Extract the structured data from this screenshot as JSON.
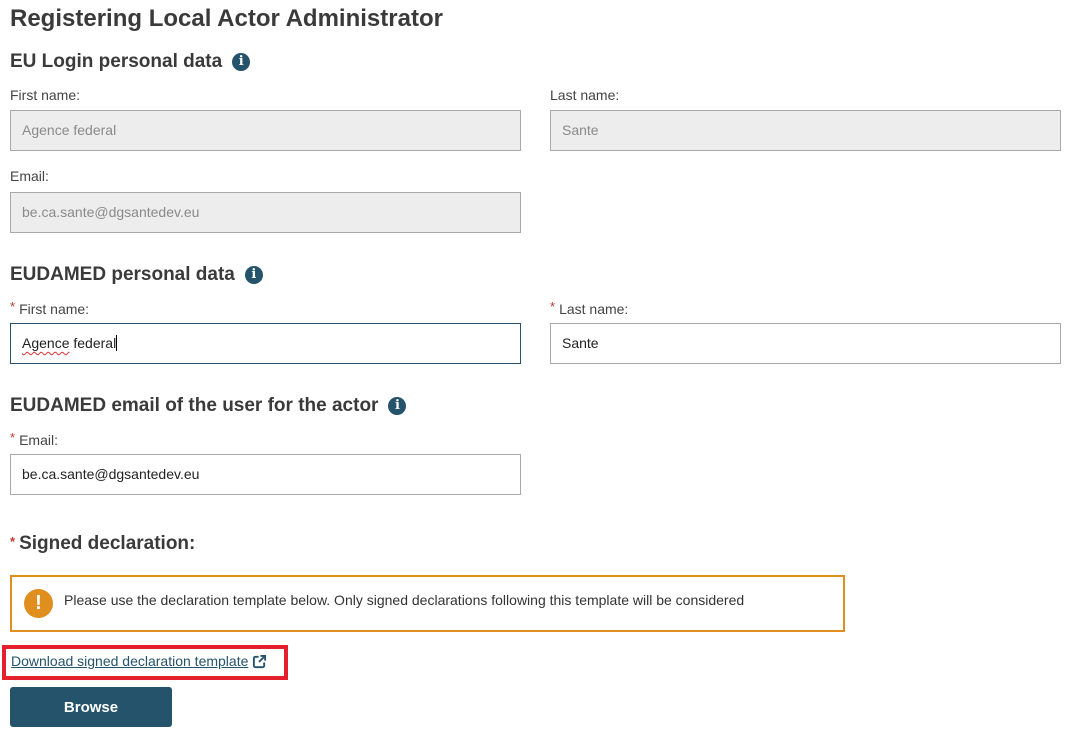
{
  "page": {
    "title": "Registering Local Actor Administrator"
  },
  "eu_login": {
    "title": "EU Login personal data",
    "first_name_label": "First name:",
    "first_name_value": "Agence federal",
    "last_name_label": "Last name:",
    "last_name_value": "Sante",
    "email_label": "Email:",
    "email_value": "be.ca.sante@dgsantedev.eu"
  },
  "eudamed_personal": {
    "title": "EUDAMED personal data",
    "required_mark": "*",
    "first_name_label": "First name:",
    "first_name_value_a": "Agence",
    "first_name_value_b": " federal",
    "last_name_label": "Last name:",
    "last_name_value": "Sante"
  },
  "eudamed_email": {
    "title": "EUDAMED email of the user for the actor",
    "required_mark": "*",
    "email_label": "Email:",
    "email_value": "be.ca.sante@dgsantedev.eu"
  },
  "declaration": {
    "required_mark": "*",
    "title": "Signed declaration:",
    "warning_icon": "!",
    "warning_text": "Please use the declaration template below. Only signed declarations following this template will be considered",
    "download_link": "Download signed declaration template",
    "browse_label": "Browse"
  },
  "icons": {
    "info": "i",
    "info_color": "#24536b",
    "warning_color": "#e08e1d",
    "highlight_color": "#e3202b"
  }
}
